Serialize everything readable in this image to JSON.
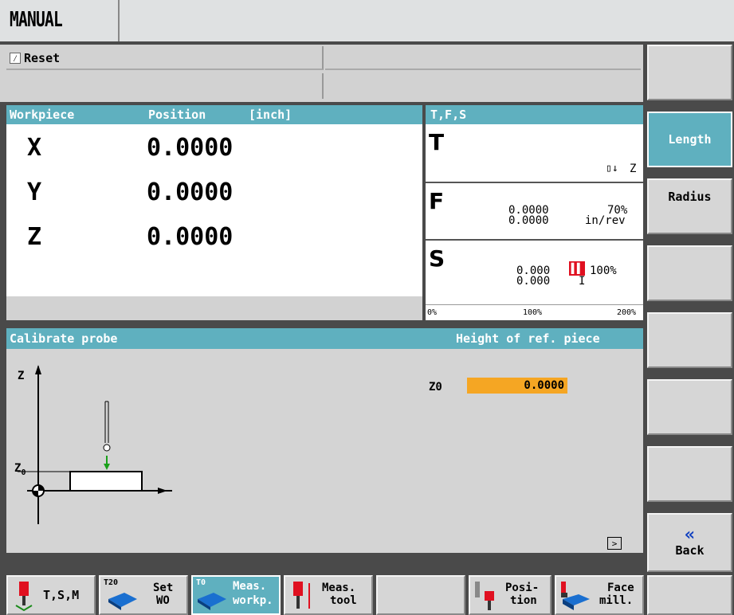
{
  "header": {
    "mode": "MANUAL"
  },
  "status": {
    "reset_label": "Reset"
  },
  "position": {
    "header_workpiece": "Workpiece",
    "header_position": "Position",
    "header_unit": "[inch]",
    "axes": [
      {
        "name": "X",
        "value": "0.0000"
      },
      {
        "name": "Y",
        "value": "0.0000"
      },
      {
        "name": "Z",
        "value": "0.0000"
      }
    ]
  },
  "tfs": {
    "title": "T,F,S",
    "t_label": "T",
    "t_axis": "Z",
    "f_label": "F",
    "f_value1": "0.0000",
    "f_value2": "0.0000",
    "f_percent": "70%",
    "f_unit": "in/rev",
    "s_label": "S",
    "s_value1": "0.000",
    "s_value2": "0.000",
    "s_percent": "100%",
    "s_unit": "I",
    "scale": [
      "0%",
      "100%",
      "200%"
    ]
  },
  "calibrate": {
    "title": "Calibrate probe",
    "subtitle": "Height of ref. piece",
    "z0_label": "Z0",
    "z0_value": "0.0000",
    "diagram_z": "Z",
    "diagram_z0": "Z",
    "diagram_z0_sub": "0"
  },
  "vertical_softkeys": [
    "",
    "Length",
    "Radius",
    "",
    "",
    "",
    "",
    "Back"
  ],
  "horizontal_softkeys": [
    {
      "label": "T,S,M",
      "icon": "tool-icon"
    },
    {
      "label1": "Set",
      "label2": "WO",
      "badge": "T20",
      "icon": "workpiece-icon"
    },
    {
      "label1": "Meas.",
      "label2": "workp.",
      "badge": "T0",
      "icon": "measure-workpiece-icon"
    },
    {
      "label1": "Meas.",
      "label2": "tool",
      "icon": "measure-tool-icon"
    },
    {
      "label": "",
      "icon": ""
    },
    {
      "label1": "Posi-",
      "label2": "tion",
      "icon": "position-icon"
    },
    {
      "label1": "Face",
      "label2": "mill.",
      "icon": "face-mill-icon"
    },
    {
      "label": "",
      "icon": ""
    }
  ],
  "colors": {
    "teal": "#5fb0bf",
    "orange": "#f5a623",
    "active_key": "#5fb0bf",
    "red": "#e01020"
  }
}
